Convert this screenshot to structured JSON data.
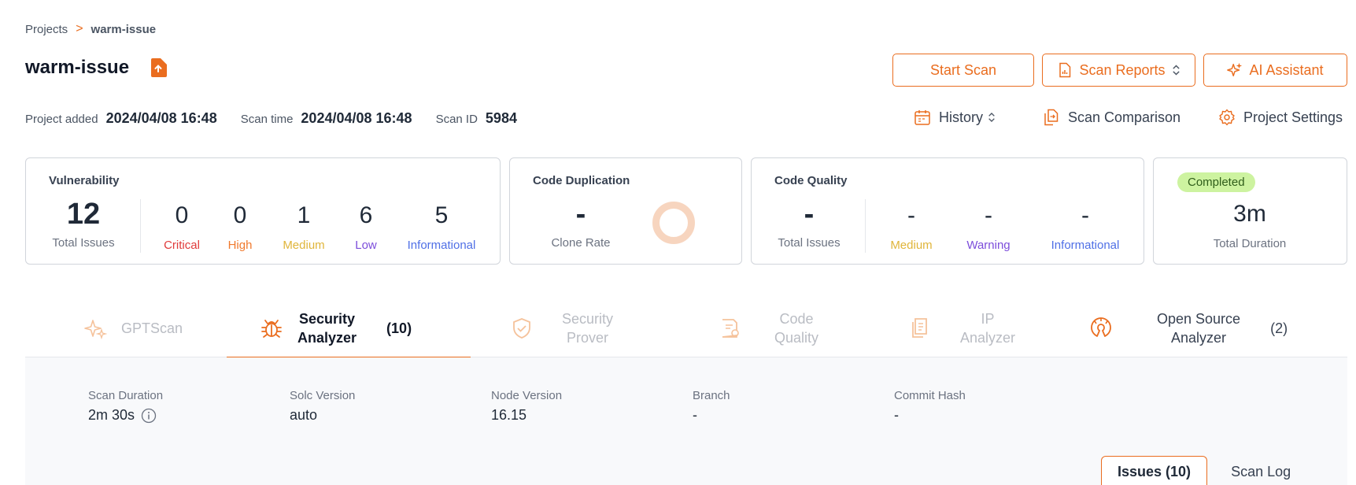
{
  "breadcrumb": {
    "root": "Projects",
    "separator": ">",
    "current": "warm-issue"
  },
  "project": {
    "name": "warm-issue"
  },
  "actions": {
    "start_scan": "Start Scan",
    "scan_reports": "Scan Reports",
    "ai_assistant": "AI Assistant"
  },
  "meta": {
    "added_label": "Project added",
    "added_value": "2024/04/08 16:48",
    "scan_time_label": "Scan time",
    "scan_time_value": "2024/04/08 16:48",
    "scan_id_label": "Scan ID",
    "scan_id_value": "5984"
  },
  "toolbar": {
    "history": "History",
    "scan_comparison": "Scan Comparison",
    "project_settings": "Project Settings"
  },
  "vulnerability": {
    "title": "Vulnerability",
    "total": "12",
    "total_label": "Total Issues",
    "critical": "0",
    "critical_label": "Critical",
    "high": "0",
    "high_label": "High",
    "medium": "1",
    "medium_label": "Medium",
    "low": "6",
    "low_label": "Low",
    "informational": "5",
    "informational_label": "Informational"
  },
  "code_duplication": {
    "title": "Code Duplication",
    "value": "-",
    "label": "Clone Rate"
  },
  "code_quality": {
    "title": "Code Quality",
    "total": "-",
    "total_label": "Total Issues",
    "medium": "-",
    "medium_label": "Medium",
    "warning": "-",
    "warning_label": "Warning",
    "informational": "-",
    "informational_label": "Informational"
  },
  "status": {
    "badge": "Completed",
    "duration": "3m",
    "duration_label": "Total Duration"
  },
  "analyzer_tabs": {
    "gptscan": "GPTScan",
    "security_analyzer_1": "Security",
    "security_analyzer_2": "Analyzer",
    "security_analyzer_count": "(10)",
    "security_prover_1": "Security",
    "security_prover_2": "Prover",
    "code_quality_1": "Code",
    "code_quality_2": "Quality",
    "ip_analyzer_1": "IP",
    "ip_analyzer_2": "Analyzer",
    "open_source_1": "Open Source",
    "open_source_2": "Analyzer",
    "open_source_count": "(2)"
  },
  "details": {
    "scan_duration_label": "Scan Duration",
    "scan_duration_value": "2m 30s",
    "solc_label": "Solc Version",
    "solc_value": "auto",
    "node_label": "Node Version",
    "node_value": "16.15",
    "branch_label": "Branch",
    "branch_value": "-",
    "commit_label": "Commit Hash",
    "commit_value": "-"
  },
  "subtabs": {
    "issues": "Issues (10)",
    "scan_log": "Scan Log"
  },
  "colors": {
    "accent": "#ea6d1f",
    "critical": "#e03a3a",
    "high": "#f07a2e",
    "medium": "#e0b53a",
    "low": "#7c4ddb",
    "informational": "#4f6fe6",
    "completed_bg": "#cdf3a0"
  }
}
